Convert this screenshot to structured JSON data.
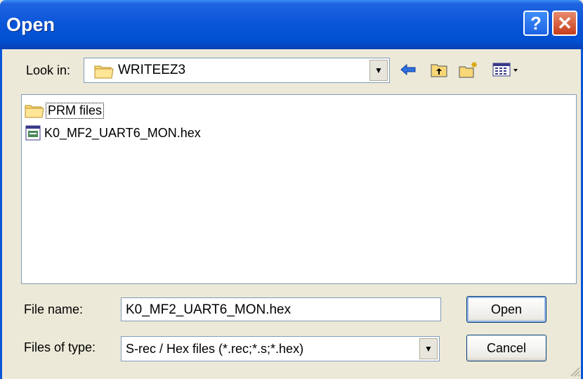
{
  "window": {
    "title": "Open",
    "help_symbol": "?",
    "close_symbol": "✕"
  },
  "look_in": {
    "label": "Look in:",
    "value": "WRITEEZ3"
  },
  "toolbar": {
    "back": "back-icon",
    "up": "up-folder-icon",
    "new_folder": "new-folder-icon",
    "view_menu": "view-menu-icon"
  },
  "files": [
    {
      "name": "PRM files",
      "type": "folder"
    },
    {
      "name": "K0_MF2_UART6_MON.hex",
      "type": "file"
    }
  ],
  "file_name": {
    "label": "File name:",
    "value": "K0_MF2_UART6_MON.hex"
  },
  "file_type": {
    "label": "Files of type:",
    "value": "S-rec / Hex files (*.rec;*.s;*.hex)"
  },
  "buttons": {
    "open": "Open",
    "cancel": "Cancel"
  },
  "colors": {
    "title_bar": "#0050d0",
    "face": "#ECE9D8",
    "close": "#c63d1a"
  }
}
